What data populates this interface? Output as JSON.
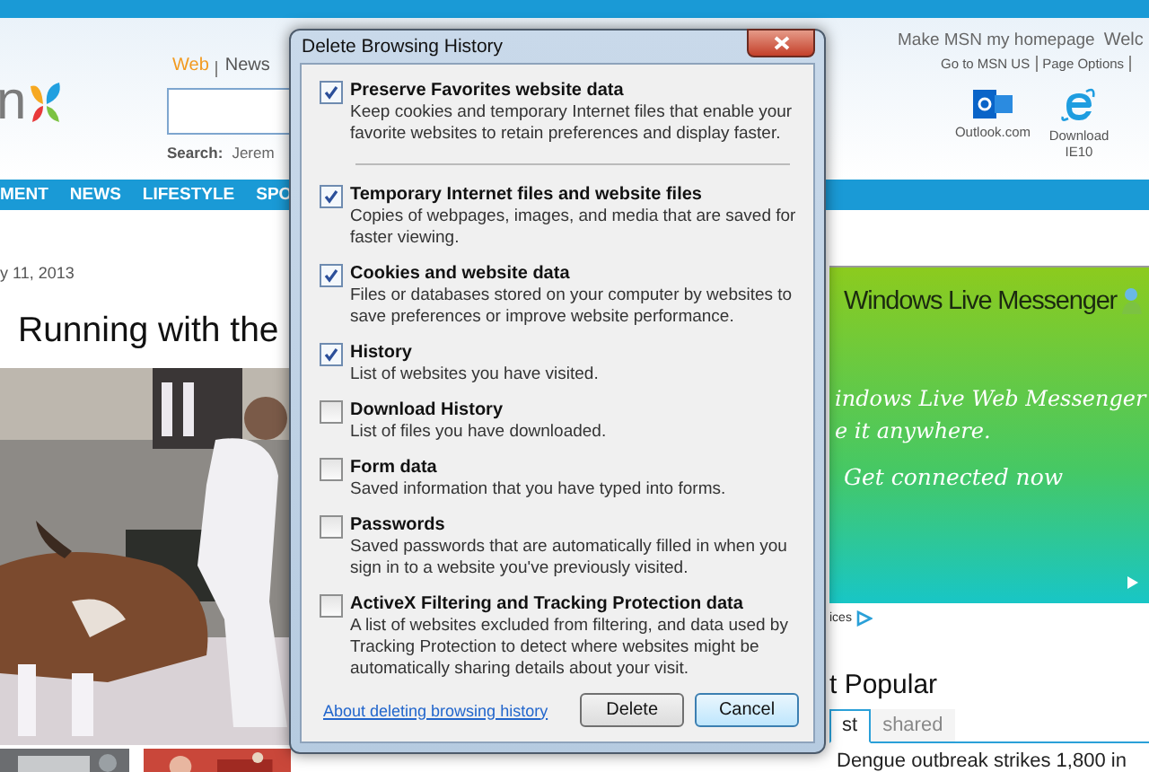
{
  "page": {
    "logo_text": "n",
    "search_tabs": [
      {
        "label": "Web",
        "selected": true
      },
      {
        "label": "News",
        "selected": false
      }
    ],
    "search_label": "Search:",
    "search_trend": "Jerem",
    "nav": [
      "MENT",
      "NEWS",
      "LIFESTYLE",
      "SPO"
    ],
    "header_links": {
      "homepage": "Make MSN my homepage",
      "welcome": "Welc",
      "links": [
        "Go to MSN US",
        "Page Options"
      ]
    },
    "header_apps": [
      {
        "kind": "outlook",
        "label": "Outlook.com"
      },
      {
        "kind": "ie",
        "label": "Download IE10"
      }
    ],
    "date": "y 11, 2013",
    "headline": "Running with the",
    "ad": {
      "brand": "Windows Live Messenger",
      "lines": [
        "indows Live Web Messenger",
        "e it anywhere."
      ],
      "cta": "Get connected now",
      "choices": "ices"
    },
    "popular": {
      "title": "t Popular",
      "tabs": [
        {
          "label": "st",
          "selected": true
        },
        {
          "label": "shared",
          "selected": false
        }
      ],
      "headline": "Dengue outbreak strikes 1,800 in"
    }
  },
  "dialog": {
    "title": "Delete Browsing History",
    "preserve": {
      "label": "Preserve Favorites website data",
      "description": "Keep cookies and temporary Internet files that enable your favorite websites to retain preferences and display faster.",
      "checked": true
    },
    "options": [
      {
        "label": "Temporary Internet files and website files",
        "description": "Copies of webpages, images, and media that are saved for faster viewing.",
        "checked": true
      },
      {
        "label": "Cookies and website data",
        "description": "Files or databases stored on your computer by websites to save preferences or improve website performance.",
        "checked": true
      },
      {
        "label": "History",
        "description": "List of websites you have visited.",
        "checked": true
      },
      {
        "label": "Download History",
        "description": "List of files you have downloaded.",
        "checked": false
      },
      {
        "label": "Form data",
        "description": "Saved information that you have typed into forms.",
        "checked": false
      },
      {
        "label": "Passwords",
        "description": "Saved passwords that are automatically filled in when you sign in to a website you've previously visited.",
        "checked": false
      },
      {
        "label": "ActiveX Filtering and Tracking Protection data",
        "description": "A list of websites excluded from filtering, and data used by Tracking Protection to detect where websites might be automatically sharing details about your visit.",
        "checked": false
      }
    ],
    "link": "About deleting browsing history",
    "buttons": [
      {
        "label": "Delete",
        "default": false
      },
      {
        "label": "Cancel",
        "default": true
      }
    ]
  }
}
